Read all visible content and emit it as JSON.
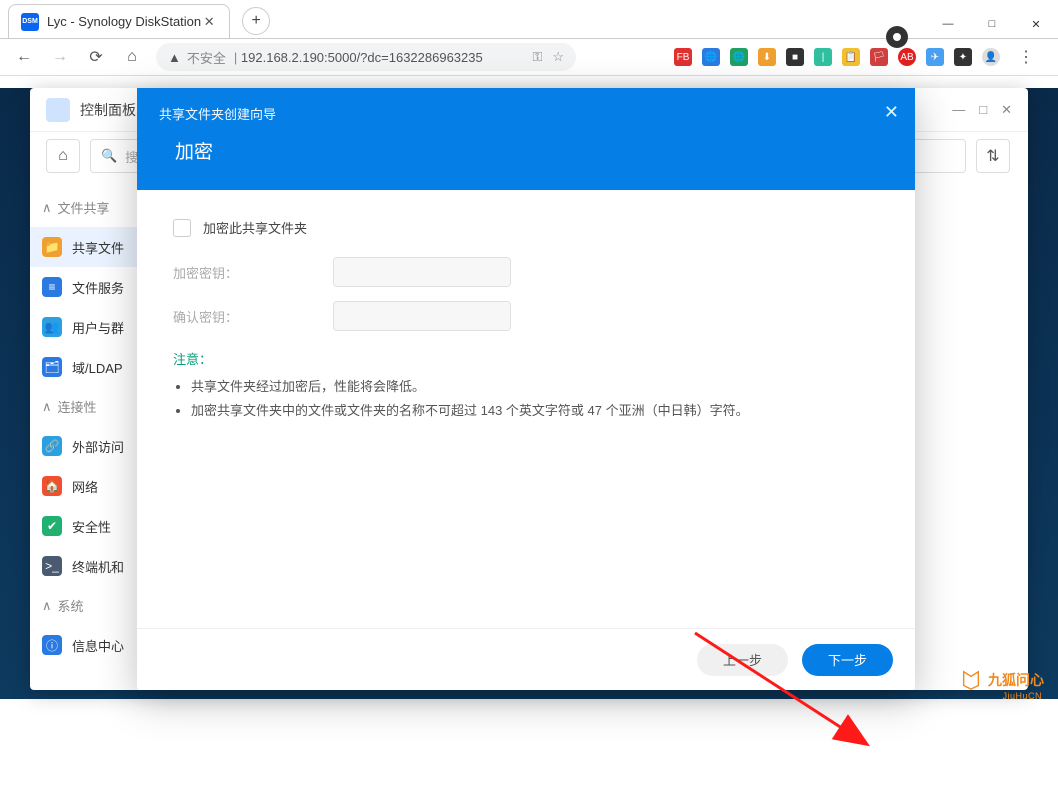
{
  "browser": {
    "tab_title": "Lyc - Synology DiskStation",
    "favicon_text": "DSM",
    "insecure_label": "不安全",
    "url": "192.168.2.190:5000/?dc=1632286963235",
    "extensions": [
      "FB",
      "v1",
      "v2",
      "dl",
      "sq",
      "ic",
      "ph",
      "fl",
      "ABP",
      "bd",
      "pz",
      "av"
    ]
  },
  "window_controls": {
    "min": "—",
    "max": "□",
    "close": "✕"
  },
  "dsm": {
    "header_title": "控制面板",
    "win_min": "—",
    "win_max": "□",
    "win_close": "✕",
    "home_icon": "⌂",
    "search_placeholder": "搜索",
    "sort_icon": "⇅"
  },
  "sidebar": {
    "sections": [
      {
        "label": "文件共享",
        "chev": "∧"
      },
      {
        "label": "连接性",
        "chev": "∧"
      },
      {
        "label": "系统",
        "chev": "∧"
      }
    ],
    "items_fs": [
      {
        "icon": "📁",
        "color": "#f0a030",
        "label": "共享文件"
      },
      {
        "icon": "≡",
        "color": "#2a7ae2",
        "label": "文件服务"
      },
      {
        "icon": "👥",
        "color": "#2aa0e2",
        "label": "用户与群"
      },
      {
        "icon": "🗂",
        "color": "#2a7ae2",
        "label": "域/LDAP"
      }
    ],
    "items_conn": [
      {
        "icon": "🔗",
        "color": "#2aa0e2",
        "label": "外部访问"
      },
      {
        "icon": "🏠",
        "color": "#f05030",
        "label": "网络"
      },
      {
        "icon": "✔",
        "color": "#20b070",
        "label": "安全性"
      },
      {
        "icon": ">_",
        "color": "#4a5a70",
        "label": "终端机和"
      }
    ],
    "items_sys": [
      {
        "icon": "ⓘ",
        "color": "#2a7ae2",
        "label": "信息中心"
      }
    ]
  },
  "modal": {
    "wizard_title": "共享文件夹创建向导",
    "step_title": "加密",
    "close": "✕",
    "checkbox_label": "加密此共享文件夹",
    "field_key": "加密密钥：",
    "field_confirm": "确认密钥：",
    "note_title": "注意：",
    "note1": "共享文件夹经过加密后，性能将会降低。",
    "note2": "加密共享文件夹中的文件或文件夹的名称不可超过 143 个英文字符或 47 个亚洲（中日韩）字符。",
    "btn_prev": "上一步",
    "btn_next": "下一步"
  },
  "watermark": {
    "text": "九狐问心",
    "sub": "JiuHuCN"
  }
}
